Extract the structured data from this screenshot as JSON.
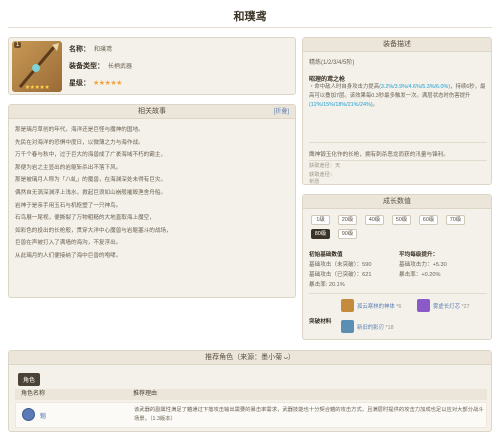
{
  "page": {
    "title": "和璞鸢"
  },
  "weapon": {
    "level_badge": "1",
    "name_label": "名称",
    "name_value": "和璞鸢",
    "type_label": "装备类型",
    "type_value": "长柄武器",
    "rarity_label": "星级",
    "stars": "★★★★★",
    "rarity": 5
  },
  "story": {
    "title": "相关故事",
    "edit_label": "[折叠]",
    "lines": [
      "那是璃月草创的年代，海洋还是巨怪与魔神的国地。",
      "先民在对海洋的恐惧中度日，以微薄之力与海作战。",
      "万千个春与秋中，过于巨大的海兽成了广袤海域不朽的霸主，",
      "那便为岩之主显出的岩躯斩杀出不落下风。",
      "那是被璃月人称为「八虬」的魔兽，在海渊深处未得有巨灾。",
      "偶然自无涡深渊浮上浅水，掀起巨浪如山崩般摧毁渔舍舟船。",
      "岩神于是亲手用玉石与机枢塑了一只神鸟。",
      "石鸟展一尾视，便撕裂了万物粗糙的大地直取海上魔空，",
      "如彩色的投出的长枪般，贯穿大洋中心魔兽与岩躯塞斗的战场，",
      "巨兽在声被打入了满墙的海沟，不复浮出。",
      "从此璃月的人们便接纳了海中巨兽的咆哮。"
    ]
  },
  "effect": {
    "title": "装备描述",
    "refine": "精炼(1/2/3/4/5阶)",
    "name": "昭理的鸢之枪",
    "text_parts": [
      "・命中敌人时自身攻击力提高",
      "(3.2%/3.9%/4.6%/5.3%/6.0%)",
      "，持续6秒，最高可以叠加7层。该效果每0.3秒最多触发一次。满层状态时伤害提升",
      "(12%/15%/18%/21%/24%)",
      "。"
    ],
    "description": "鹰神锻玉化作的长枪，拥有刺杀恶龙而获的汛量与锋利。",
    "obtain_label": "获取途径：天",
    "extra_label": "获取途径：",
    "extra_value": "祈愿"
  },
  "stats": {
    "title": "成长数值",
    "levels": [
      "1级",
      "20级",
      "40级",
      "50级",
      "60级",
      "70级",
      "80级",
      "90级"
    ],
    "active_level": "80级",
    "initial_header": "初始基础数值",
    "initial": [
      "基础攻击（未突破）：590",
      "基础攻击（已突破）：621",
      "暴击率: 20.1%"
    ],
    "avg_header": "平均每级提升：",
    "avg": [
      "基础攻击力：+5.30",
      "暴击率：+0.20%"
    ],
    "materials_label": "突破材料",
    "materials": [
      {
        "name": "孤云寒林的神体",
        "count": "*6",
        "color": "#c58b3d"
      },
      {
        "name": "雾虚长灯芯",
        "count": "*27",
        "color": "#8a5ac9"
      },
      {
        "name": "新旧的影刃",
        "count": "*18",
        "color": "#5a8fb5"
      }
    ]
  },
  "recommend": {
    "title": "推荐角色（来源：墨小菊 ᴗ）",
    "tab": "角色",
    "col_name": "角色名称",
    "col_reason": "推荐理由",
    "characters": [
      {
        "name": "魈",
        "reason": "该武器的副属性满足了魈通过下落攻击输出需要的暴击率需求，武器技能也十分契合魈的攻击方式，且满层时提供的攻击力加成也足以应对大部分战斗场景。（1.3版本）"
      }
    ]
  },
  "colors": {
    "highlight": "#1a9fd6",
    "link": "#5b7fb5",
    "panel": "#f4f1ea"
  }
}
